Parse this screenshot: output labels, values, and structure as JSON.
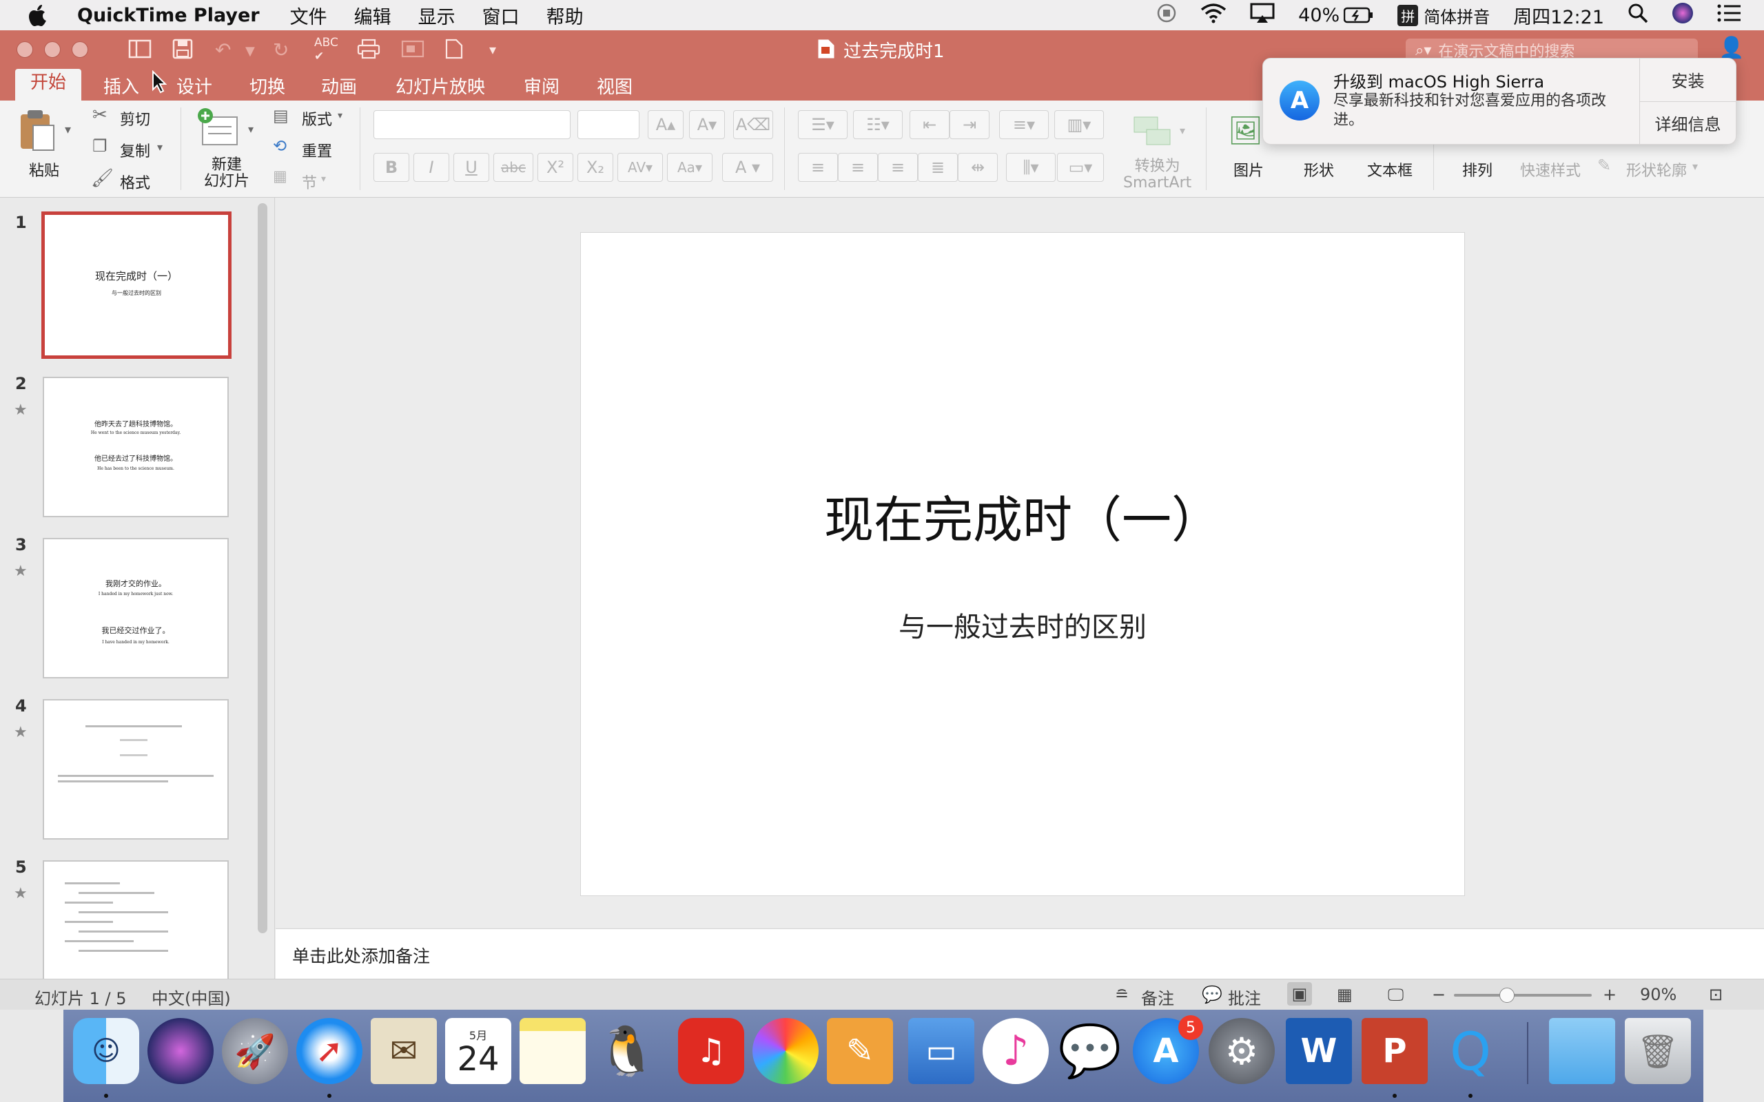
{
  "menubar": {
    "app_name": "QuickTime Player",
    "menus": [
      "文件",
      "编辑",
      "显示",
      "窗口",
      "帮助"
    ],
    "battery": "40%",
    "input_method": "简体拼音",
    "clock": "周四12:21"
  },
  "window": {
    "doc_title": "过去完成时1",
    "search_placeholder": "在演示文稿中的搜索"
  },
  "ribbon_tabs": [
    "开始",
    "插入",
    "设计",
    "切换",
    "动画",
    "幻灯片放映",
    "审阅",
    "视图"
  ],
  "ribbon": {
    "paste": "粘贴",
    "cut": "剪切",
    "copy": "复制",
    "format": "格式",
    "new_slide": "新建\n幻灯片",
    "layout": "版式",
    "reset": "重置",
    "section": "节",
    "smartart": "转换为\nSmartArt",
    "picture": "图片",
    "shape": "形状",
    "textbox": "文本框",
    "arrange": "排列",
    "quick_styles": "快速样式",
    "shape_outline": "形状轮廓"
  },
  "notification": {
    "title": "升级到 macOS High Sierra",
    "body": "尽享最新科技和针对您喜爱应用的各项改进。",
    "install": "安装",
    "details": "详细信息"
  },
  "thumbnails": [
    {
      "num": "1",
      "line1": "现在完成时（一）",
      "line2": "与一般过去时的区别"
    },
    {
      "num": "2",
      "a": "他昨天去了趟科技博物馆。",
      "b": "He went to the science museum yesterday.",
      "c": "他已经去过了科技博物馆。",
      "d": "He has been to the science museum."
    },
    {
      "num": "3",
      "a": "我刚才交的作业。",
      "b": "I handed in my homework just now.",
      "c": "我已经交过作业了。",
      "d": "I have handed in my homework."
    },
    {
      "num": "4"
    },
    {
      "num": "5"
    }
  ],
  "slide": {
    "title": "现在完成时（一）",
    "subtitle": "与一般过去时的区别"
  },
  "notes_placeholder": "单击此处添加备注",
  "status": {
    "slide_count": "幻灯片 1 / 5",
    "language": "中文(中国)",
    "notes": "备注",
    "comments": "批注",
    "zoom": "90%",
    "zoom_level": 0.38
  },
  "dock": {
    "calendar_month": "5月",
    "calendar_day": "24",
    "appstore_badge": "5",
    "apps": [
      "finder-icon",
      "siri-icon",
      "launchpad-icon",
      "safari-icon",
      "mail-icon",
      "calendar-icon",
      "notes-icon",
      "qq-icon",
      "netease-music-icon",
      "photos-icon",
      "pages-icon",
      "keynote-icon",
      "itunes-icon",
      "wechat-icon",
      "app-store-icon",
      "system-preferences-icon",
      "word-icon",
      "powerpoint-icon",
      "quicktime-icon",
      "folder-icon",
      "trash-icon"
    ]
  },
  "colors": {
    "accent": "#cd6f63",
    "active_tab_text": "#c3463a",
    "selected_border": "#c8413c"
  }
}
